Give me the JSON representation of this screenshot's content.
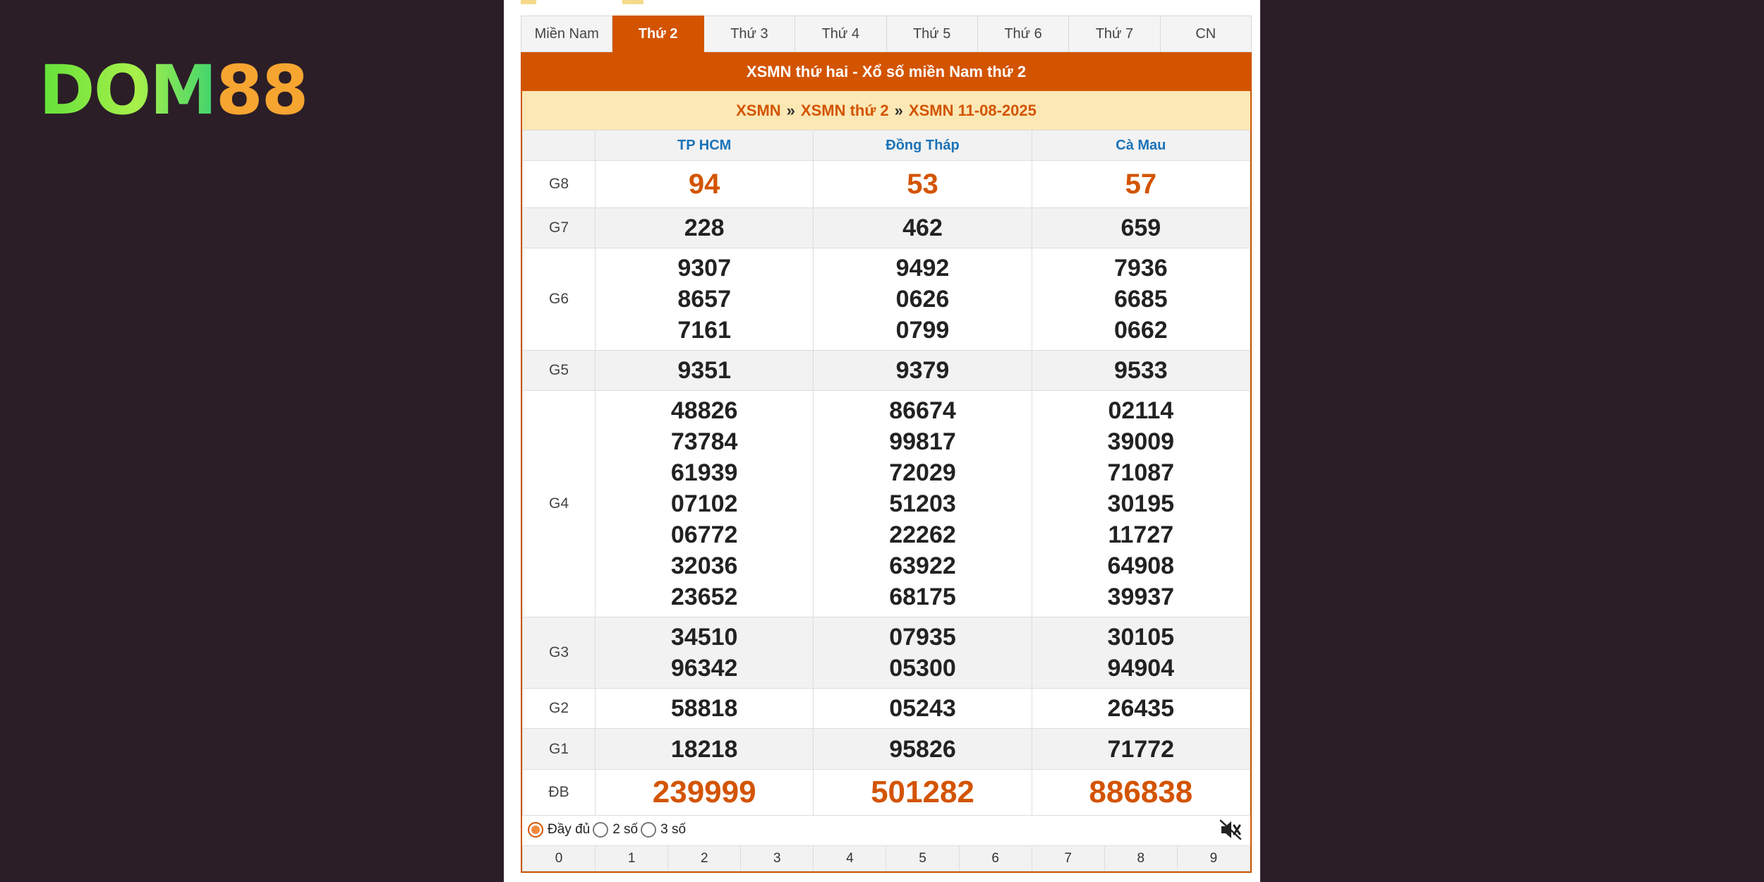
{
  "logo": {
    "part1": "DOM",
    "part2": "88"
  },
  "tabs": [
    {
      "label": "Miền Nam",
      "active": false
    },
    {
      "label": "Thứ 2",
      "active": true
    },
    {
      "label": "Thứ 3",
      "active": false
    },
    {
      "label": "Thứ 4",
      "active": false
    },
    {
      "label": "Thứ 5",
      "active": false
    },
    {
      "label": "Thứ 6",
      "active": false
    },
    {
      "label": "Thứ 7",
      "active": false
    },
    {
      "label": "CN",
      "active": false
    }
  ],
  "title": "XSMN thứ hai - Xổ số miền Nam thứ 2",
  "breadcrumb": [
    "XSMN",
    "XSMN thứ 2",
    "XSMN 11-08-2025"
  ],
  "breadcrumb_sep": "»",
  "provinces": [
    "TP HCM",
    "Đồng Tháp",
    "Cà Mau"
  ],
  "prizes": [
    {
      "label": "G8",
      "values": [
        [
          "94"
        ],
        [
          "53"
        ],
        [
          "57"
        ]
      ]
    },
    {
      "label": "G7",
      "values": [
        [
          "228"
        ],
        [
          "462"
        ],
        [
          "659"
        ]
      ]
    },
    {
      "label": "G6",
      "values": [
        [
          "9307",
          "8657",
          "7161"
        ],
        [
          "9492",
          "0626",
          "0799"
        ],
        [
          "7936",
          "6685",
          "0662"
        ]
      ]
    },
    {
      "label": "G5",
      "values": [
        [
          "9351"
        ],
        [
          "9379"
        ],
        [
          "9533"
        ]
      ]
    },
    {
      "label": "G4",
      "values": [
        [
          "48826",
          "73784",
          "61939",
          "07102",
          "06772",
          "32036",
          "23652"
        ],
        [
          "86674",
          "99817",
          "72029",
          "51203",
          "22262",
          "63922",
          "68175"
        ],
        [
          "02114",
          "39009",
          "71087",
          "30195",
          "11727",
          "64908",
          "39937"
        ]
      ]
    },
    {
      "label": "G3",
      "values": [
        [
          "34510",
          "96342"
        ],
        [
          "07935",
          "05300"
        ],
        [
          "30105",
          "94904"
        ]
      ]
    },
    {
      "label": "G2",
      "values": [
        [
          "58818"
        ],
        [
          "05243"
        ],
        [
          "26435"
        ]
      ]
    },
    {
      "label": "G1",
      "values": [
        [
          "18218"
        ],
        [
          "95826"
        ],
        [
          "71772"
        ]
      ]
    },
    {
      "label": "ĐB",
      "values": [
        [
          "239999"
        ],
        [
          "501282"
        ],
        [
          "886838"
        ]
      ]
    }
  ],
  "display_options": [
    {
      "label": "Đầy đủ",
      "selected": true
    },
    {
      "label": "2 số",
      "selected": false
    },
    {
      "label": "3 số",
      "selected": false
    }
  ],
  "digits": [
    "0",
    "1",
    "2",
    "3",
    "4",
    "5",
    "6",
    "7",
    "8",
    "9"
  ],
  "colors": {
    "accent": "#d35400",
    "breadcrumb_bg": "#fbe8b5",
    "province": "#1a73b8",
    "background": "#2b1e27"
  }
}
